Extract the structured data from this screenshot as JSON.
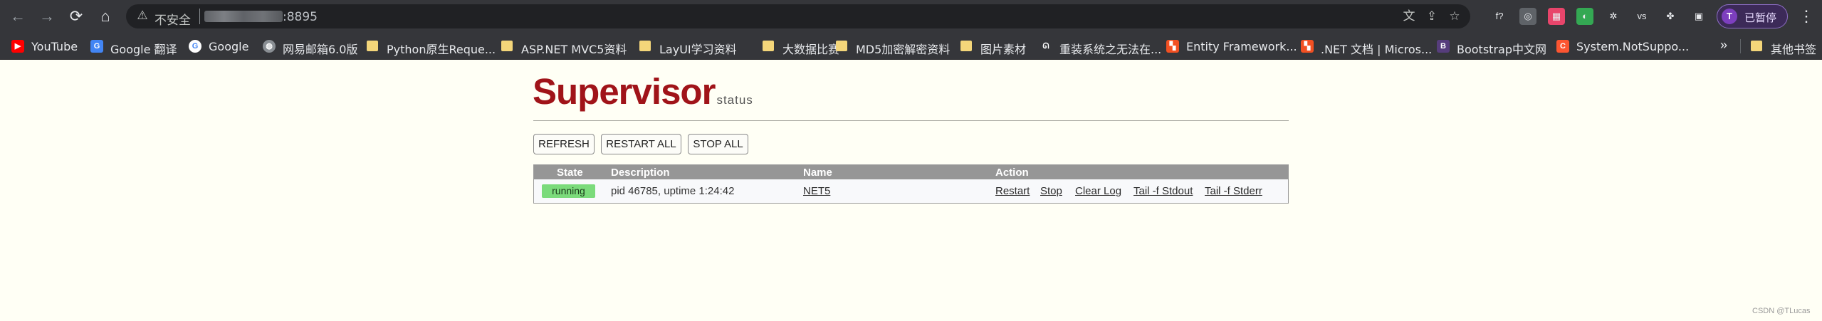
{
  "browser": {
    "omnibox": {
      "security_label": "不安全",
      "url_suffix": ":8895"
    },
    "profile": {
      "initial": "T",
      "label": "已暂停"
    },
    "extensions": [
      {
        "name": "font-f-icon",
        "glyph": "f?",
        "bg": "#35363a"
      },
      {
        "name": "extension-glasses-icon",
        "glyph": "◎",
        "bg": "#5f6368"
      },
      {
        "name": "extension-colorful-grid-icon",
        "glyph": "▦",
        "bg": "#e8456b"
      },
      {
        "name": "extension-green-icon",
        "glyph": "◐",
        "bg": "#34a853"
      },
      {
        "name": "extension-openai-icon",
        "glyph": "✲",
        "bg": "#35363a"
      },
      {
        "name": "extension-vs-icon",
        "glyph": "vs",
        "bg": "#35363a"
      },
      {
        "name": "puzzle-icon",
        "glyph": "✤",
        "bg": "#35363a"
      },
      {
        "name": "sidebar-icon",
        "glyph": "▣",
        "bg": "#35363a"
      }
    ],
    "bookmarks": [
      {
        "label": "YouTube",
        "icon": "youtube-icon",
        "glyph": "▶",
        "color": "#ff0000"
      },
      {
        "label": "Google 翻译",
        "icon": "google-translate-icon",
        "glyph": "G",
        "color": "#4285f4"
      },
      {
        "label": "Google",
        "icon": "google-icon",
        "glyph": "G",
        "color": "#ffffff"
      },
      {
        "label": "网易邮箱6.0版",
        "icon": "globe-icon",
        "glyph": "◍",
        "color": "#8a8f94"
      },
      {
        "label": "Python原生Reque...",
        "icon": "folder-icon",
        "folder": true
      },
      {
        "label": "ASP.NET MVC5资料",
        "icon": "folder-icon",
        "folder": true
      },
      {
        "label": "LayUI学习资料",
        "icon": "folder-icon",
        "folder": true
      },
      {
        "label": "大数据比赛",
        "icon": "folder-icon",
        "folder": true
      },
      {
        "label": "MD5加密解密资料",
        "icon": "folder-icon",
        "folder": true
      },
      {
        "label": "图片素材",
        "icon": "folder-icon",
        "folder": true
      },
      {
        "label": "重装系统之无法在...",
        "icon": "paw-icon",
        "glyph": "ᘏ",
        "color": "#35363a"
      },
      {
        "label": "Entity Framework...",
        "icon": "microsoft-icon",
        "glyph": "▚",
        "color": "#f25022"
      },
      {
        "label": ".NET 文档 | Micros...",
        "icon": "microsoft-icon",
        "glyph": "▚",
        "color": "#f25022"
      },
      {
        "label": "Bootstrap中文网",
        "icon": "bootstrap-icon",
        "glyph": "B",
        "color": "#563d7c"
      },
      {
        "label": "System.NotSuppo...",
        "icon": "csdn-icon",
        "glyph": "C",
        "color": "#fc5531"
      }
    ],
    "bookmarks_more": "»",
    "other_bookmarks": "其他书签"
  },
  "page": {
    "logo_main": "Supervisor",
    "logo_sub": "status",
    "buttons": {
      "refresh": "REFRESH",
      "restart_all": "RESTART ALL",
      "stop_all": "STOP ALL"
    },
    "table": {
      "headers": {
        "state": "State",
        "description": "Description",
        "name": "Name",
        "action": "Action"
      },
      "rows": [
        {
          "state": "running",
          "description": "pid 46785, uptime 1:24:42",
          "name": "NET5",
          "actions": {
            "restart": "Restart",
            "stop": "Stop",
            "clear_log": "Clear Log",
            "tail_stdout": "Tail -f Stdout",
            "tail_stderr": "Tail -f Stderr"
          }
        }
      ]
    },
    "watermark": "CSDN @TLucas"
  },
  "colors": {
    "logo_red": "#a01419",
    "page_bg": "#fffff5",
    "running_green": "#7bdb7b",
    "table_header": "#969696"
  }
}
